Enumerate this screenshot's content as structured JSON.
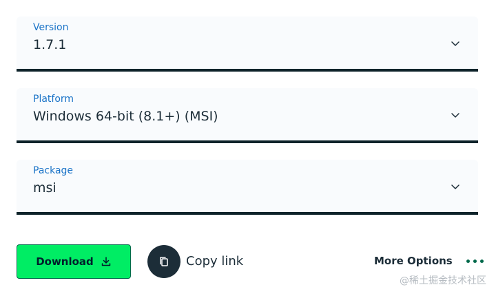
{
  "version": {
    "label": "Version",
    "value": "1.7.1"
  },
  "platform": {
    "label": "Platform",
    "value": "Windows 64-bit (8.1+) (MSI)"
  },
  "package": {
    "label": "Package",
    "value": "msi"
  },
  "actions": {
    "download_label": "Download",
    "copy_link_label": "Copy link",
    "more_options_label": "More Options"
  },
  "watermark": "@稀土掘金技术社区",
  "icons": {
    "dropdown": "chevron-down-icon",
    "download": "download-icon",
    "copy": "copy-icon",
    "more": "more-dots-icon"
  },
  "colors": {
    "accent_green": "#00ed64",
    "dark_green": "#00684a",
    "label_blue": "#1a73c7",
    "dark": "#1c2d38",
    "underline": "#0e232a"
  }
}
